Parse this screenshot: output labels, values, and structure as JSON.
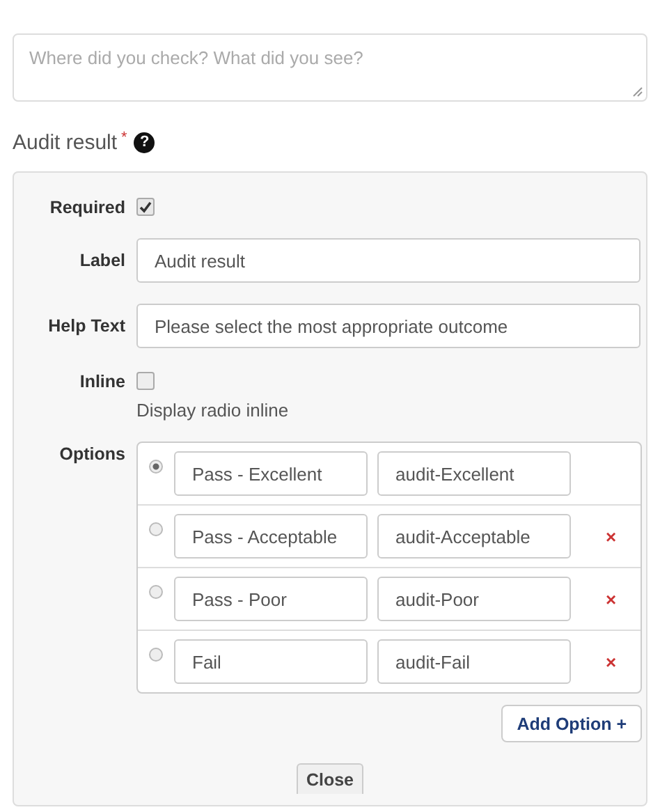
{
  "details": {
    "placeholder": "Where did you check? What did you see?"
  },
  "field_title": {
    "label": "Audit result",
    "required_mark": "*",
    "help_icon": "?"
  },
  "editor": {
    "required": {
      "label": "Required",
      "checked": true
    },
    "label": {
      "label": "Label",
      "value": "Audit result"
    },
    "help_text": {
      "label": "Help Text",
      "value": "Please select the most appropriate outcome"
    },
    "inline": {
      "label": "Inline",
      "checked": false,
      "description": "Display radio inline"
    },
    "options": {
      "label": "Options",
      "items": [
        {
          "selected": true,
          "label": "Pass - Excellent",
          "value": "audit-Excellent"
        },
        {
          "selected": false,
          "label": "Pass - Acceptable",
          "value": "audit-Acceptable",
          "remove": "×"
        },
        {
          "selected": false,
          "label": "Pass - Poor",
          "value": "audit-Poor",
          "remove": "×"
        },
        {
          "selected": false,
          "label": "Fail",
          "value": "audit-Fail",
          "remove": "×"
        }
      ]
    },
    "add_button": "Add Option +",
    "close_button": "Close"
  }
}
